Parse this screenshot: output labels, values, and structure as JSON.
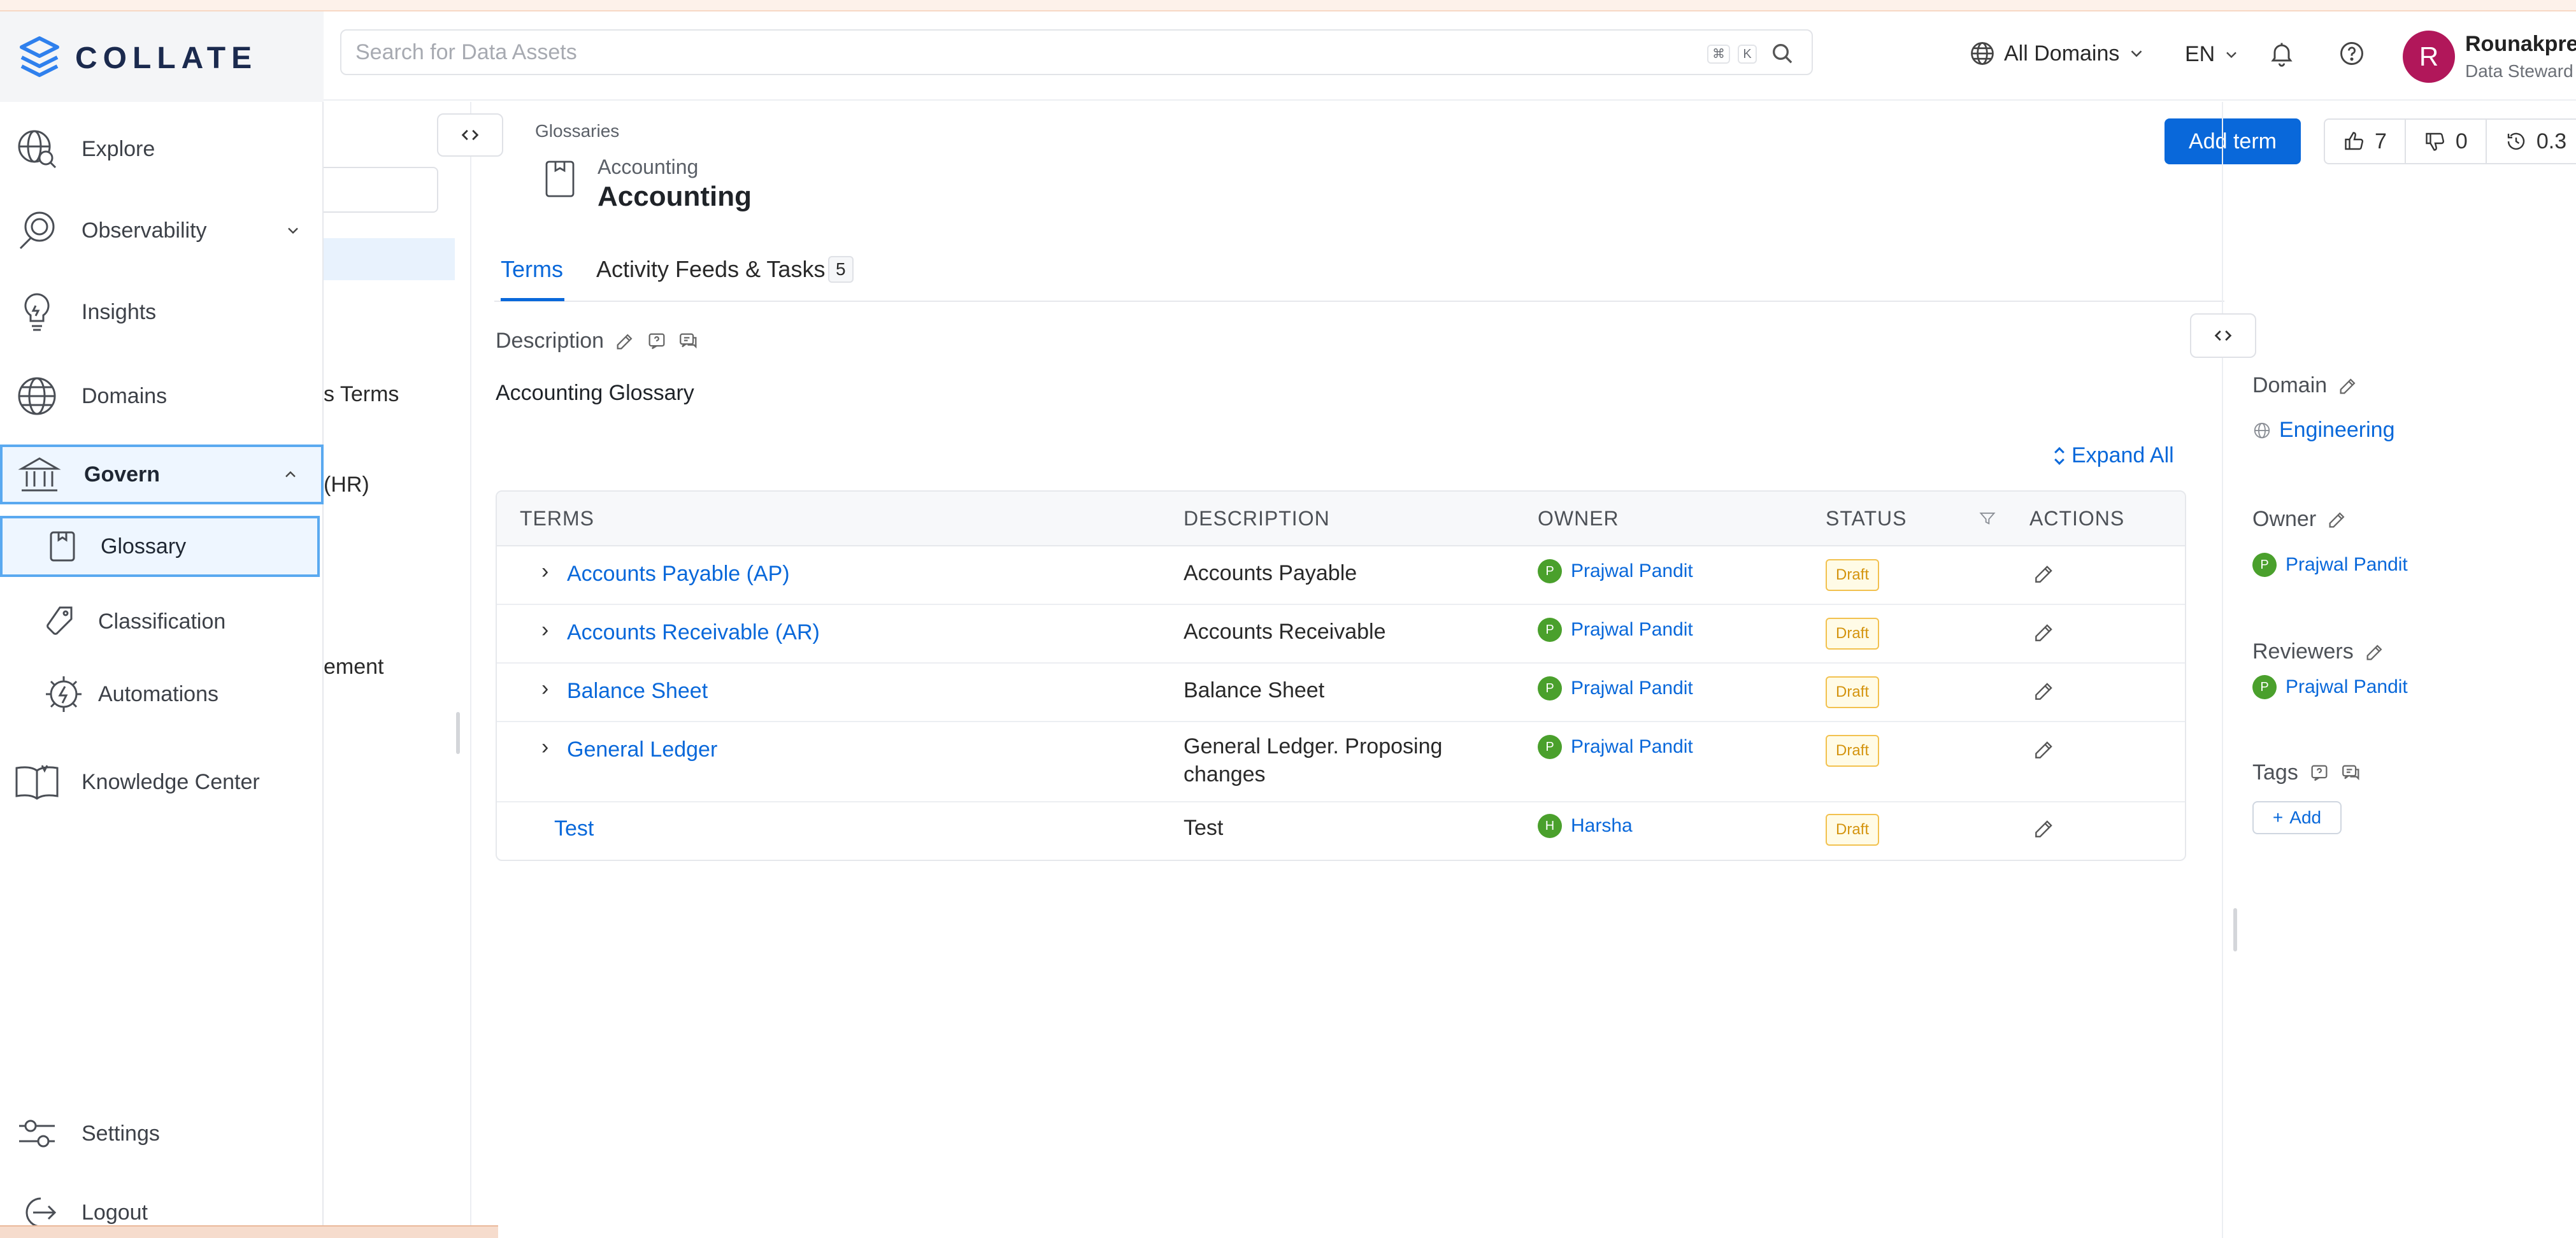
{
  "header": {
    "search_placeholder": "Search for Data Assets",
    "kbd_cmd": "⌘",
    "kbd_k": "K",
    "domains_label": "All Domains",
    "language": "EN",
    "user_initial": "R",
    "user_name": "Rounakpre",
    "user_role": "Data Steward"
  },
  "brand": {
    "name": "COLLATE"
  },
  "sidebar": {
    "explore": "Explore",
    "observability": "Observability",
    "insights": "Insights",
    "domains": "Domains",
    "govern": "Govern",
    "glossary": "Glossary",
    "classification": "Classification",
    "automations": "Automations",
    "knowledge_center": "Knowledge Center",
    "settings": "Settings",
    "logout": "Logout"
  },
  "glossary_list": {
    "fragments": [
      "s Terms",
      "(HR)",
      "ement"
    ]
  },
  "page": {
    "breadcrumb": "Glossaries",
    "entity_subtitle": "Accounting",
    "entity_title": "Accounting",
    "add_term": "Add term",
    "upvotes": "7",
    "downvotes": "0",
    "version": "0.3"
  },
  "tabs": {
    "terms": "Terms",
    "activity": "Activity Feeds & Tasks",
    "activity_count": "5"
  },
  "description": {
    "label": "Description",
    "text": "Accounting Glossary"
  },
  "table": {
    "expand_all": "Expand All",
    "headers": {
      "terms": "TERMS",
      "description": "DESCRIPTION",
      "owner": "OWNER",
      "status": "STATUS",
      "actions": "ACTIONS"
    },
    "rows": [
      {
        "term": "Accounts Payable (AP)",
        "description": "Accounts Payable",
        "owner_initial": "P",
        "owner": "Prajwal Pandit",
        "status": "Draft"
      },
      {
        "term": "Accounts Receivable (AR)",
        "description": "Accounts Receivable",
        "owner_initial": "P",
        "owner": "Prajwal Pandit",
        "status": "Draft"
      },
      {
        "term": "Balance Sheet",
        "description": "Balance Sheet",
        "owner_initial": "P",
        "owner": "Prajwal Pandit",
        "status": "Draft"
      },
      {
        "term": "General Ledger",
        "description": "General Ledger. Proposing changes",
        "owner_initial": "P",
        "owner": "Prajwal Pandit",
        "status": "Draft"
      },
      {
        "term": "Test",
        "description": "Test",
        "owner_initial": "H",
        "owner": "Harsha",
        "status": "Draft"
      }
    ]
  },
  "right_panel": {
    "domain_label": "Domain",
    "domain_value": "Engineering",
    "owner_label": "Owner",
    "owner_initial": "P",
    "owner_value": "Prajwal Pandit",
    "reviewers_label": "Reviewers",
    "reviewer_initial": "P",
    "reviewer_value": "Prajwal Pandit",
    "tags_label": "Tags",
    "tags_add": "Add"
  },
  "colors": {
    "accent": "#0968da",
    "owner_avatar": "#4aa02c",
    "user_avatar": "#b1175a",
    "draft_badge": "#d4940f"
  }
}
